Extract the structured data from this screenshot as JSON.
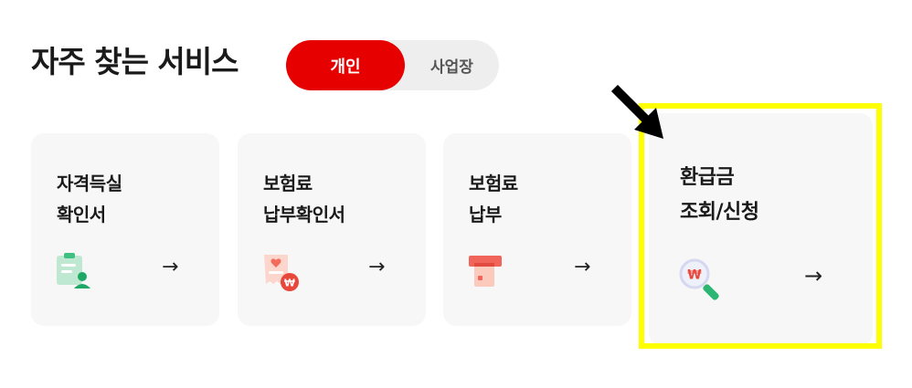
{
  "section": {
    "title": "자주 찾는 서비스",
    "toggle": {
      "options": [
        "개인",
        "사업장"
      ],
      "selected": "개인"
    }
  },
  "services": [
    {
      "line1": "자격득실",
      "line2": "확인서",
      "icon": "clipboard-user-icon",
      "arrow": "→"
    },
    {
      "line1": "보험료",
      "line2": "납부확인서",
      "icon": "receipt-won-icon",
      "arrow": "→"
    },
    {
      "line1": "보험료",
      "line2": "납부",
      "icon": "card-payment-icon",
      "arrow": "→"
    },
    {
      "line1": "환급금",
      "line2": "조회/신청",
      "icon": "search-won-icon",
      "arrow": "→"
    }
  ],
  "colors": {
    "accent": "#e60000",
    "highlight": "#ffff00",
    "card_bg": "#f7f7f7"
  }
}
